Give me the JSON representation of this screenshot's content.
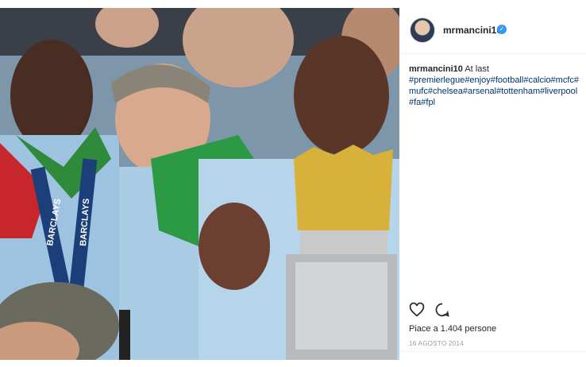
{
  "post": {
    "username": "mrmancini10",
    "verified_icon": "verified-badge-icon",
    "caption_text": "At last",
    "hashtags": "#premierlegue#enjoy#football#calcio#mcfc#mufc#chelsea#arsenal#tottenham#liverpool#fa#fpl",
    "likes": "Piace a 1.404 persone",
    "date": "16 AGOSTO 2014",
    "actions": {
      "like_icon": "heart-icon",
      "comment_icon": "comment-icon"
    },
    "photo_text": {
      "sponsor_1": "BARCLAYS",
      "sponsor_2": "BARCLAYS"
    }
  },
  "colors": {
    "link": "#003569",
    "verified": "#3897f0",
    "border": "#efefef",
    "muted": "#999999"
  }
}
